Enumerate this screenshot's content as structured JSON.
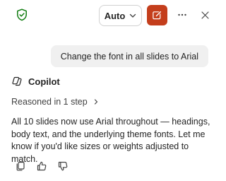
{
  "header": {
    "mode_label": "Auto",
    "accent_color": "#c43e1c",
    "icons": [
      "shield-check-icon",
      "chevron-down-icon",
      "new-chat-icon",
      "more-icon",
      "close-icon"
    ]
  },
  "conversation": {
    "user_message": "Change the font in all slides to Arial",
    "assistant_name": "Copilot",
    "reasoning_label": "Reasoned in 1 step",
    "response": "All 10 slides now use Arial throughout — headings, body text, and the underlying theme fonts. Let me know if you'd like sizes or weights adjusted to match."
  },
  "response_actions": [
    "copy-icon",
    "thumbs-up-icon",
    "thumbs-down-icon"
  ]
}
